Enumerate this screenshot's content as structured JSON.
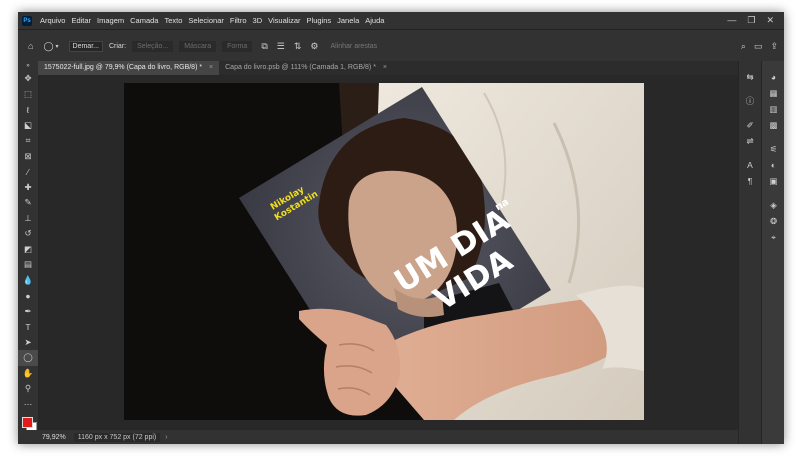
{
  "app": {
    "logo": "Ps"
  },
  "menu": [
    "Arquivo",
    "Editar",
    "Imagem",
    "Camada",
    "Texto",
    "Selecionar",
    "Filtro",
    "3D",
    "Visualizar",
    "Plugins",
    "Janela",
    "Ajuda"
  ],
  "window_controls": {
    "minimize": "—",
    "restore": "❐",
    "close": "✕"
  },
  "options_bar": {
    "home_icon": "home-icon",
    "preset_value": "Demar...",
    "create_label": "Criar:",
    "selection_btn": "Seleção...",
    "mask_btn": "Máscara",
    "shape_btn": "Forma",
    "align_edges": "Alinhar arestas"
  },
  "tabs": [
    {
      "label": "1575022-full.jpg @ 79,9% (Capa do livro, RGB/8) *",
      "close": "×"
    },
    {
      "label": "Capa do livro.psb @ 111% (Camada 1, RGB/8) *",
      "close": "×"
    }
  ],
  "book": {
    "author_line1": "Nikolay",
    "author_line2": "Kostantin",
    "title_line1": "UM DIA",
    "title_small": "na",
    "title_line2": "VIDA"
  },
  "status": {
    "zoom": "79,92%",
    "doc_info": "1160 px x 752 px (72 ppi)",
    "arrow": "›"
  },
  "colors": {
    "foreground": "#e21b1b",
    "background": "#ffffff",
    "author_text": "#f2dd1c"
  }
}
